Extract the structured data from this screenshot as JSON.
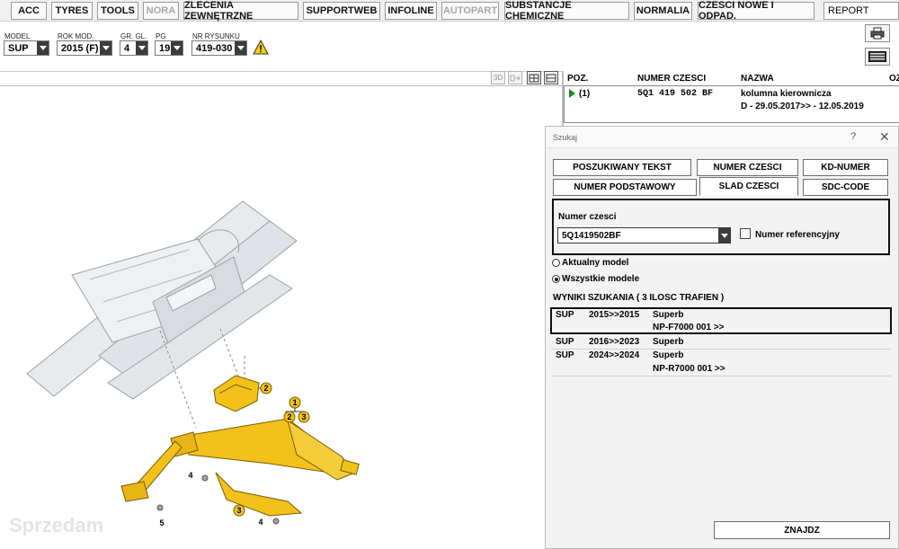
{
  "tabs": [
    {
      "label": "ACC",
      "enabled": true
    },
    {
      "label": "TYRES",
      "enabled": true
    },
    {
      "label": "TOOLS",
      "enabled": true
    },
    {
      "label": "NORA",
      "enabled": false
    },
    {
      "label": "ZLECENIA ZEWNĘTRZNE",
      "enabled": true
    },
    {
      "label": "SUPPORTWEB",
      "enabled": true
    },
    {
      "label": "INFOLINE",
      "enabled": true
    },
    {
      "label": "AUTOPART",
      "enabled": false
    },
    {
      "label": "SUBSTANCJE CHEMICZNE",
      "enabled": true
    },
    {
      "label": "NORMALIA",
      "enabled": true
    },
    {
      "label": "CZESCI NOWE I ODPAD.",
      "enabled": true
    }
  ],
  "report_select": "REPORT",
  "filters": {
    "model": {
      "label": "MODEL",
      "value": "SUP"
    },
    "year": {
      "label": "ROK MOD.",
      "value": "2015 (F)"
    },
    "main_group": {
      "label": "GR. GL.",
      "value": "4"
    },
    "sub_group": {
      "label": "PG",
      "value": "19"
    },
    "drawing_no": {
      "label": "NR RYSUNKU",
      "value": "419-030"
    }
  },
  "view_buttons": {
    "three_d": "3D"
  },
  "parts_table": {
    "headers": [
      "POZ.",
      "NUMER CZESCI",
      "NAZWA",
      "OZ"
    ],
    "rows": [
      {
        "pos": "(1)",
        "part_number": "5Q1 419 502 BF",
        "name": "kolumna kierownicza",
        "detail": "D - 29.05.2017>> - 12.05.2019"
      }
    ]
  },
  "search_dialog": {
    "title": "Szukaj",
    "help": "?",
    "close": "✕",
    "mode_buttons": [
      "POSZUKIWANY TEKST",
      "NUMER CZESCI",
      "KD-NUMER",
      "NUMER PODSTAWOWY",
      "SLAD CZESCI",
      "SDC-CODE"
    ],
    "active_mode": "SLAD CZESCI",
    "field_label": "Numer czesci",
    "field_value": "5Q1419502BF",
    "reference_checkbox": "Numer referencyjny",
    "radio_current": "Aktualny model",
    "radio_all": "Wszystkie modele",
    "selected_radio": "Wszystkie modele",
    "results_title": "WYNIKI SZUKANIA  ( 3 ILOSC TRAFIEN )",
    "results": [
      {
        "model": "SUP",
        "years": "2015>>2015",
        "name": "Superb",
        "code": "NP-F7000 001 >>"
      },
      {
        "model": "SUP",
        "years": "2016>>2023",
        "name": "Superb",
        "code": ""
      },
      {
        "model": "SUP",
        "years": "2024>>2024",
        "name": "Superb",
        "code": "NP-R7000 001 >>"
      }
    ],
    "find_button": "ZNAJDZ"
  },
  "drawing": {
    "callouts": [
      "1",
      "2",
      "3",
      "2",
      "3",
      "4",
      "4",
      "5"
    ],
    "watermark": "Sprzedam"
  },
  "colors": {
    "part_yellow": "#f2c21b",
    "accent_green": "#1a8a1a",
    "warning_yellow": "#f4d000"
  }
}
